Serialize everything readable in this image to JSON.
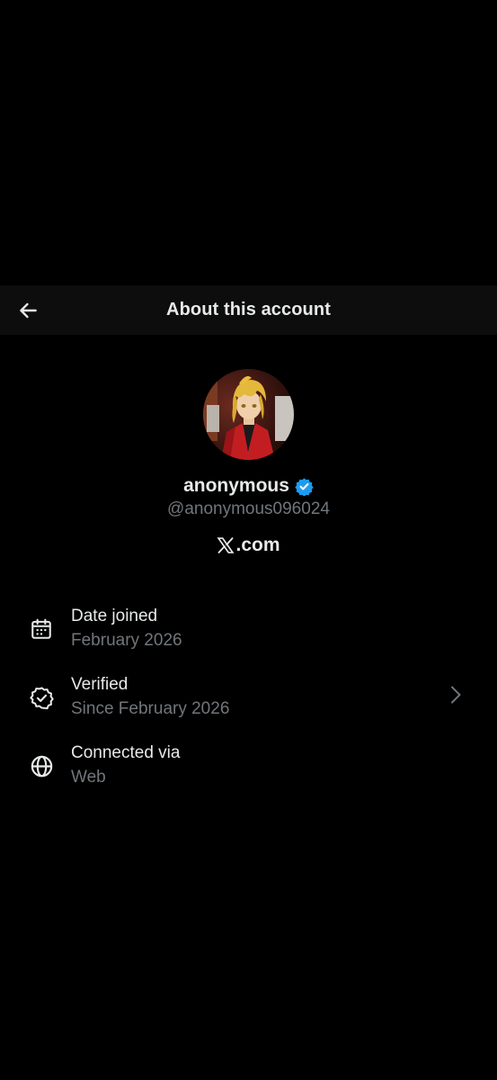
{
  "header": {
    "title": "About this account",
    "back_icon": "arrow-left-icon"
  },
  "profile": {
    "display_name": "anonymous",
    "handle": "@anonymous096024",
    "verified": true,
    "verified_badge_color": "#1d9bf0",
    "site": ".com",
    "site_logo": "x-logo-icon"
  },
  "info_items": [
    {
      "icon": "calendar-icon",
      "label": "Date joined",
      "value": "February 2026"
    },
    {
      "icon": "verified-outline-icon",
      "label": "Verified",
      "value": "Since February 2026",
      "chevron": "chevron-right-icon"
    },
    {
      "icon": "globe-icon",
      "label": "Connected via",
      "value": "Web"
    }
  ],
  "colors": {
    "background": "#000000",
    "header_background": "#0d0d0d",
    "primary_text": "#e7e9ea",
    "secondary_text": "#71767b"
  }
}
